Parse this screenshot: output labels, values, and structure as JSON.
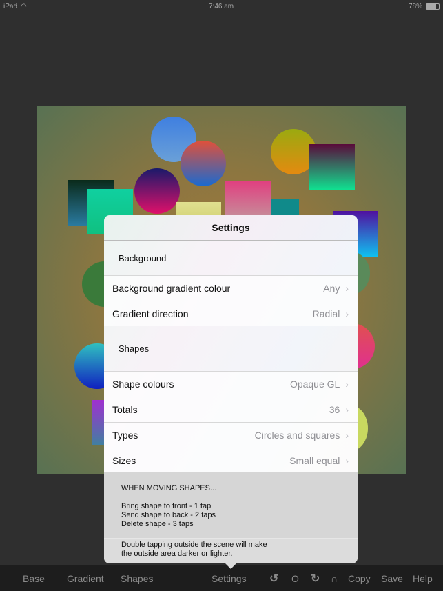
{
  "status": {
    "device": "iPad",
    "time": "7:46 am",
    "battery": "78%"
  },
  "popover": {
    "title": "Settings",
    "sections": [
      {
        "header": "Background",
        "rows": [
          {
            "label": "Background gradient colour",
            "value": "Any"
          },
          {
            "label": "Gradient direction",
            "value": "Radial"
          }
        ]
      },
      {
        "header": "Shapes",
        "rows": [
          {
            "label": "Shape colours",
            "value": "Opaque GL"
          },
          {
            "label": "Totals",
            "value": "36"
          },
          {
            "label": "Types",
            "value": "Circles and squares"
          },
          {
            "label": "Sizes",
            "value": "Small equal"
          }
        ]
      }
    ],
    "footer": {
      "heading": "WHEN MOVING SHAPES...",
      "lines": [
        "Bring shape to front - 1 tap",
        "Send shape to back - 2 taps",
        "Delete shape - 3 taps"
      ],
      "note1": "Double tapping outside the scene will make",
      "note2": "the outside area darker or lighter."
    }
  },
  "toolbar": {
    "base": "Base",
    "gradient": "Gradient",
    "shapes": "Shapes",
    "settings": "Settings",
    "undo_icon": "undo-icon",
    "reset": "O",
    "redo_icon": "redo-icon",
    "magnet": "∩",
    "copy": "Copy",
    "save": "Save",
    "help": "Help"
  }
}
